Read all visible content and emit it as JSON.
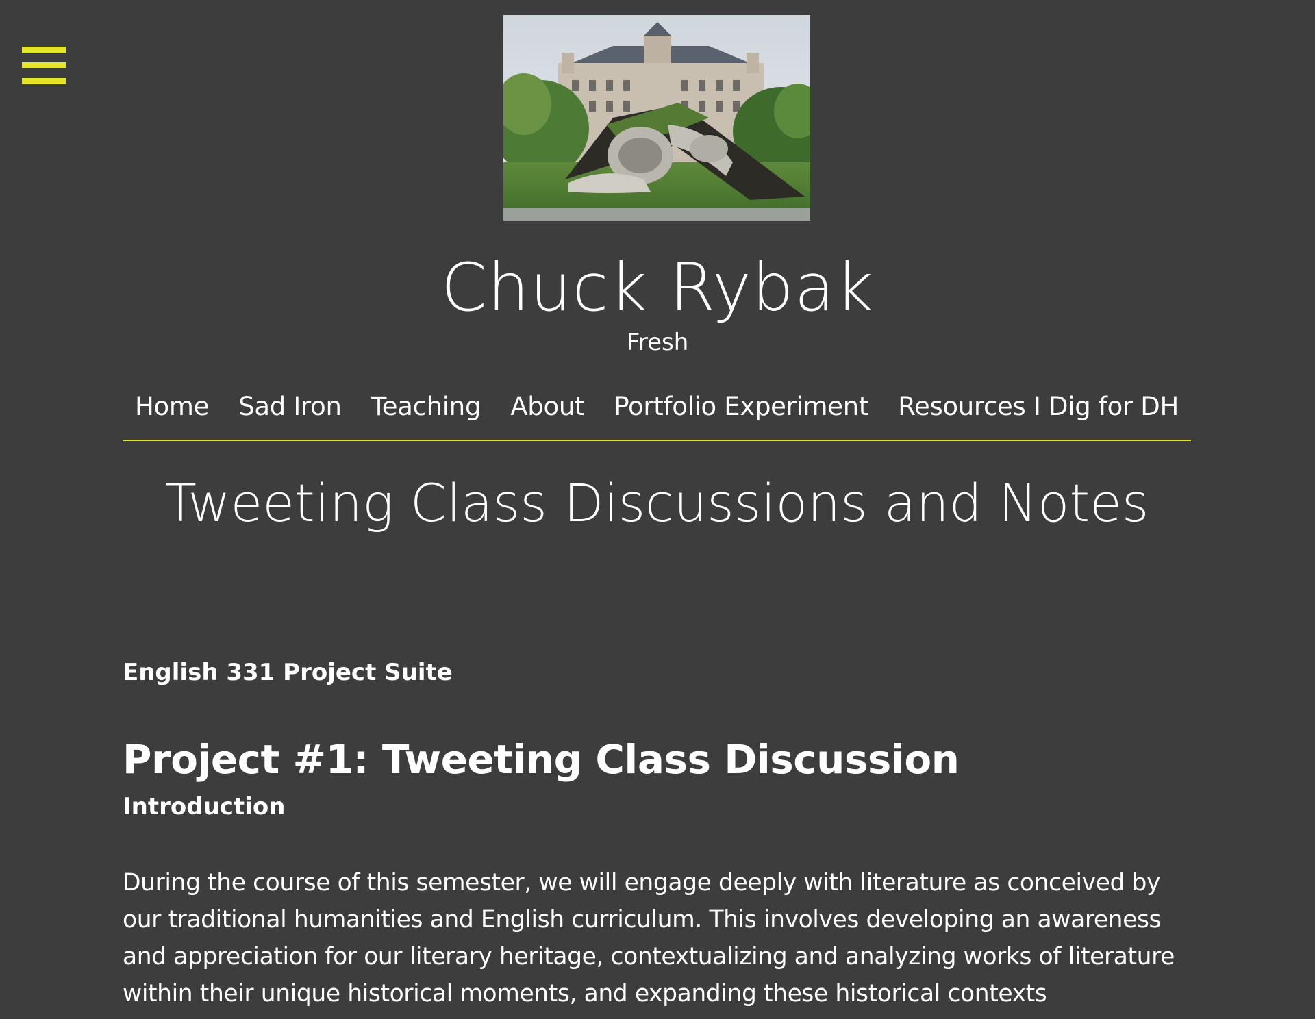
{
  "colors": {
    "background": "#3d3d3d",
    "accent": "#e4e52a",
    "text": "#ffffff"
  },
  "menu_toggle": {
    "icon": "hamburger-menu-icon"
  },
  "header_image": {
    "subject": "giant sculpture emerging from lawn in front of ornate building"
  },
  "site": {
    "title": "Chuck Rybak",
    "tagline": "Fresh"
  },
  "nav": {
    "items": [
      {
        "label": "Home"
      },
      {
        "label": "Sad Iron"
      },
      {
        "label": "Teaching"
      },
      {
        "label": "About"
      },
      {
        "label": "Portfolio Experiment"
      },
      {
        "label": "Resources I Dig for DH"
      }
    ]
  },
  "post": {
    "title": "Tweeting Class Discussions and Notes",
    "suite_label": "English 331 Project Suite",
    "project_heading": "Project #1: Tweeting Class Discussion",
    "intro_heading": "Introduction",
    "intro_text": "During the course of this semester, we will engage deeply with literature as conceived by our traditional humanities and English curriculum. This involves developing an awareness and appreciation for our literary heritage, contextualizing and analyzing works of literature within their unique historical moments, and expanding these historical contexts"
  }
}
